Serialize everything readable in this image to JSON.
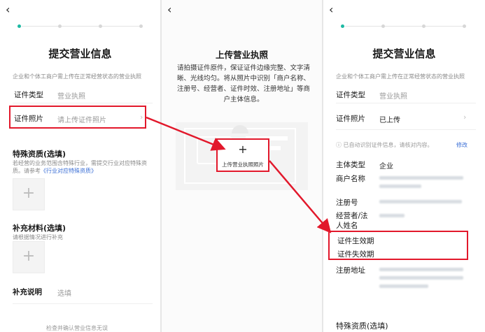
{
  "panel1": {
    "back": "‹",
    "title": "提交营业信息",
    "subtitle": "企业和个体工商户需上传在正常经营状态的营业执照",
    "cert_type": {
      "label": "证件类型",
      "value": "营业执照"
    },
    "cert_photo": {
      "label": "证件照片",
      "placeholder": "请上传证件照片",
      "chevron": "›"
    },
    "special": {
      "title": "特殊资质(选填)",
      "desc": "若经营的业务范围含特殊行业，需提交行业对应特殊资质。请参考",
      "link": "《行业对应特殊资质》"
    },
    "supplement": {
      "title": "补充材料(选填)",
      "desc": "请根据情况进行补充"
    },
    "note": {
      "label": "补充说明",
      "placeholder": "选填"
    },
    "plus": "+",
    "bottom_hint": "检查并确认营业信息无误"
  },
  "panel2": {
    "back": "‹",
    "title": "上传营业执照",
    "desc": "请拍摄证件原件，保证证件边缘完整、文字清晰、光线均匀。将从照片中识别「商户名称、注册号、经营者、证件时效、注册地址」等商户主体信息。",
    "upload_plus": "+",
    "upload_label": "上传营业执照照片"
  },
  "panel3": {
    "back": "‹",
    "title": "提交营业信息",
    "subtitle": "企业和个体工商户需上传在正常经营状态的营业执照",
    "cert_type": {
      "label": "证件类型",
      "value": "营业执照"
    },
    "cert_photo": {
      "label": "证件照片",
      "value": "已上传",
      "chevron": "›"
    },
    "info": "ⓘ 已自动识别证件信息，请核对内容。",
    "edit": "修改",
    "subject_type": {
      "label": "主体类型",
      "value": "企业"
    },
    "merchant_name": "商户名称",
    "reg_no": "注册号",
    "operator_line1": "经营者/法",
    "operator_line2": "人姓名",
    "valid_from": "证件生效期",
    "valid_to": "证件失效期",
    "reg_address": "注册地址",
    "special_title": "特殊资质(选填)"
  },
  "colors": {
    "accent": "#1db9a3",
    "highlight_red": "#e2182b",
    "link_blue": "#3b6fd6"
  }
}
